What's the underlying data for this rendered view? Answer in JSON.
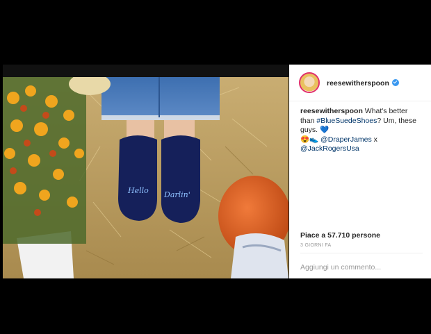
{
  "post": {
    "username": "reesewitherspoon",
    "caption": {
      "user": "reesewitherspoon",
      "text_1": " What's better than ",
      "hashtag": "#BlueSuedeShoes",
      "text_2": "? Um, these guys. ",
      "emoji_1": "💙",
      "emoji_2": "😍👟",
      "mention_1": "@DraperJames",
      "text_3": " x ",
      "mention_2": "@JackRogersUsa"
    },
    "likes": "Piace a 57.710 persone",
    "time_ago": "3 GIORNI FA",
    "comment_placeholder": "Aggiungi un commento..."
  },
  "photo": {
    "shoe_left_text": "Hello",
    "shoe_right_text": "Darlin'"
  },
  "colors": {
    "verified": "#3897f0",
    "link": "#003569",
    "avatar_ring": "#e1306c"
  }
}
